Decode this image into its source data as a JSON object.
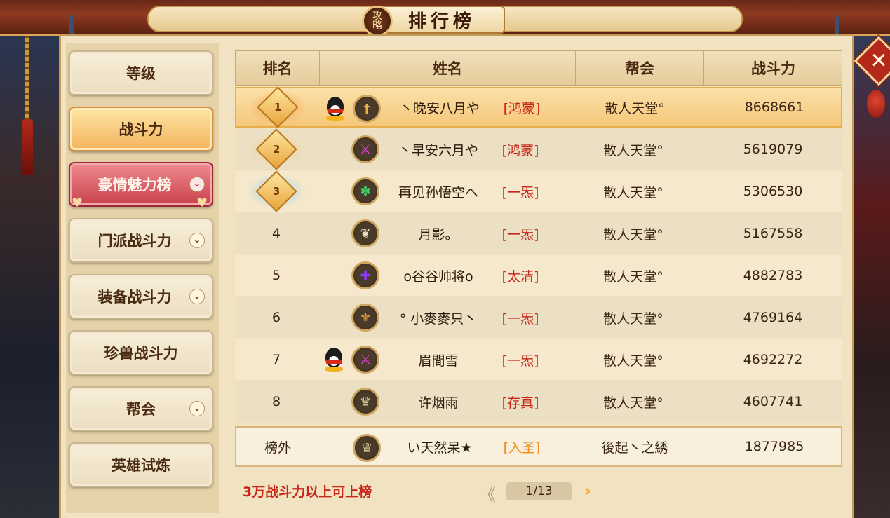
{
  "window": {
    "title": "排行榜",
    "guide_badge": [
      "攻",
      "略"
    ],
    "close_label": "✕"
  },
  "sidebar": {
    "items": [
      {
        "label": "等级",
        "state": "normal",
        "has_chevron": false
      },
      {
        "label": "战斗力",
        "state": "active",
        "has_chevron": false
      },
      {
        "label": "豪情魅力榜",
        "state": "highlight",
        "has_chevron": true
      },
      {
        "label": "门派战斗力",
        "state": "normal",
        "has_chevron": true
      },
      {
        "label": "装备战斗力",
        "state": "normal",
        "has_chevron": true
      },
      {
        "label": "珍兽战斗力",
        "state": "normal",
        "has_chevron": false
      },
      {
        "label": "帮会",
        "state": "normal",
        "has_chevron": true
      },
      {
        "label": "英雄试炼",
        "state": "normal",
        "has_chevron": false
      }
    ]
  },
  "table": {
    "columns": [
      "排名",
      "姓名",
      "帮会",
      "战斗力"
    ],
    "rows": [
      {
        "rank": "1",
        "medal": "gold",
        "qq": true,
        "school_icon": "sword-icon",
        "school_color": "#e6b84a",
        "name": "丶晚安八月や",
        "guild_tag": "[鸿蒙]",
        "tag_color": "#c8281a",
        "bang": "散人天堂°",
        "power": "8668661"
      },
      {
        "rank": "2",
        "medal": "silver",
        "qq": false,
        "school_icon": "blade-icon",
        "school_color": "#e04ad8",
        "name": "丶早安六月や",
        "guild_tag": "[鸿蒙]",
        "tag_color": "#c8281a",
        "bang": "散人天堂°",
        "power": "5619079"
      },
      {
        "rank": "3",
        "medal": "bronze",
        "qq": false,
        "school_icon": "fan-icon",
        "school_color": "#3fcf6a",
        "name": "再见孙悟空へ",
        "guild_tag": "[一炁]",
        "tag_color": "#c8281a",
        "bang": "散人天堂°",
        "power": "5306530"
      },
      {
        "rank": "4",
        "medal": "",
        "qq": false,
        "school_icon": "gourd-icon",
        "school_color": "#e6dcc0",
        "name": "月影。",
        "guild_tag": "[一炁]",
        "tag_color": "#c8281a",
        "bang": "散人天堂°",
        "power": "5167558"
      },
      {
        "rank": "5",
        "medal": "",
        "qq": false,
        "school_icon": "cross-icon",
        "school_color": "#8a3aff",
        "name": "o谷谷帅将o",
        "guild_tag": "[太清]",
        "tag_color": "#c8281a",
        "bang": "散人天堂°",
        "power": "4882783"
      },
      {
        "rank": "6",
        "medal": "",
        "qq": false,
        "school_icon": "fleur-icon",
        "school_color": "#f0b23a",
        "name": "° 小麥麥只丶",
        "guild_tag": "[一炁]",
        "tag_color": "#c8281a",
        "bang": "散人天堂°",
        "power": "4769164"
      },
      {
        "rank": "7",
        "medal": "",
        "qq": true,
        "school_icon": "blade-icon",
        "school_color": "#e04ad8",
        "name": "眉間雪",
        "guild_tag": "[一炁]",
        "tag_color": "#c8281a",
        "bang": "散人天堂°",
        "power": "4692272"
      },
      {
        "rank": "8",
        "medal": "",
        "qq": false,
        "school_icon": "dragon-icon",
        "school_color": "#d8c89a",
        "name": "许烟雨",
        "guild_tag": "[存真]",
        "tag_color": "#c8281a",
        "bang": "散人天堂°",
        "power": "4607741"
      }
    ],
    "self_row": {
      "rank": "榜外",
      "school_icon": "dragon-icon",
      "school_color": "#d8c89a",
      "name": "い天然呆★",
      "guild_tag": "[入圣]",
      "tag_color": "#f08a1a",
      "bang": "後起丶之綉",
      "power": "1877985"
    }
  },
  "footer": {
    "note": "3万战斗力以上可上榜",
    "page": "1/13",
    "prev": "《",
    "next": "›"
  },
  "colors": {
    "accent": "#f4b35c",
    "highlight": "#c9414d",
    "note": "#c8281a"
  }
}
